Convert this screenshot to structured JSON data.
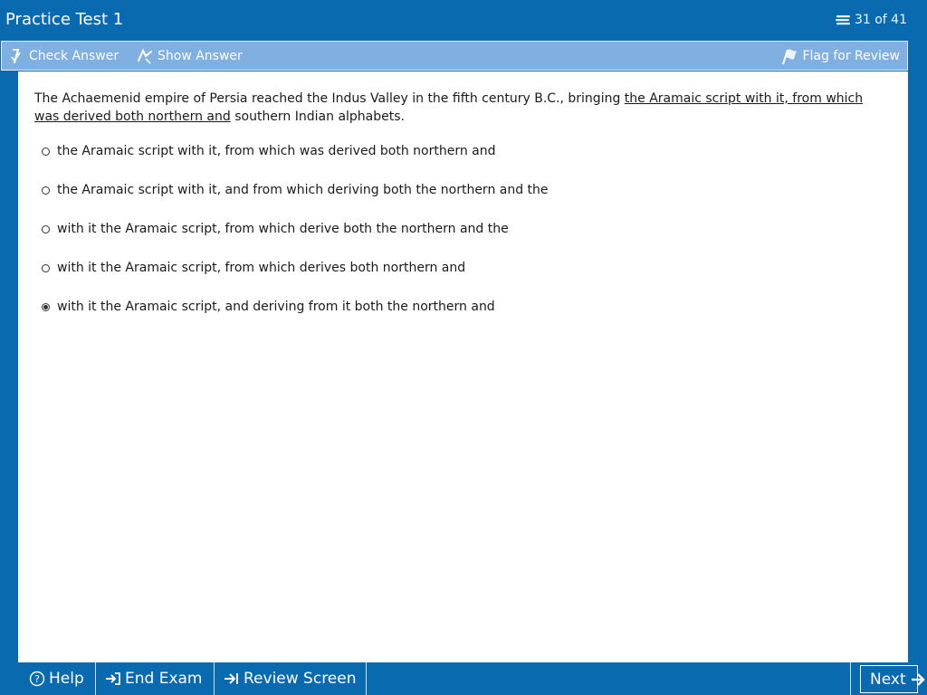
{
  "app": {
    "title": "Practice Test 1",
    "counter": "31 of 41",
    "colors": {
      "frame": "#0a6aaf",
      "toolbar": "#7fb0e1",
      "content": "#ffffff"
    }
  },
  "toolbar": {
    "check_label": "Check Answer",
    "show_label": "Show Answer",
    "flag_label": "Flag for Review",
    "icons": {
      "check": "check-pencil-icon",
      "show": "show-pencil-icon",
      "flag": "flag-icon"
    }
  },
  "question": {
    "pre": "The Achaemenid empire of Persia reached the Indus Valley in the fifth century B.C., bringing ",
    "underlined": "the Aramaic script with it, from which was derived both northern and",
    "post": " southern Indian alphabets."
  },
  "choices": [
    {
      "label": "the Aramaic script with it, from which was derived both northern and",
      "selected": false
    },
    {
      "label": "the Aramaic script with it, and from which deriving both the northern and the",
      "selected": false
    },
    {
      "label": "with it the Aramaic script, from which derive both the northern and the",
      "selected": false
    },
    {
      "label": "with it the Aramaic script, from which derives both northern and",
      "selected": false
    },
    {
      "label": "with it the Aramaic script, and deriving from it both the northern and",
      "selected": true
    }
  ],
  "bottom": {
    "help_label": "Help",
    "end_label": "End Exam",
    "review_label": "Review Screen",
    "next_label": "Next",
    "icons": {
      "help": "help-circle-icon",
      "end": "arrow-into-door-icon",
      "review": "arrow-to-bar-icon",
      "next": "arrow-right-icon"
    }
  }
}
